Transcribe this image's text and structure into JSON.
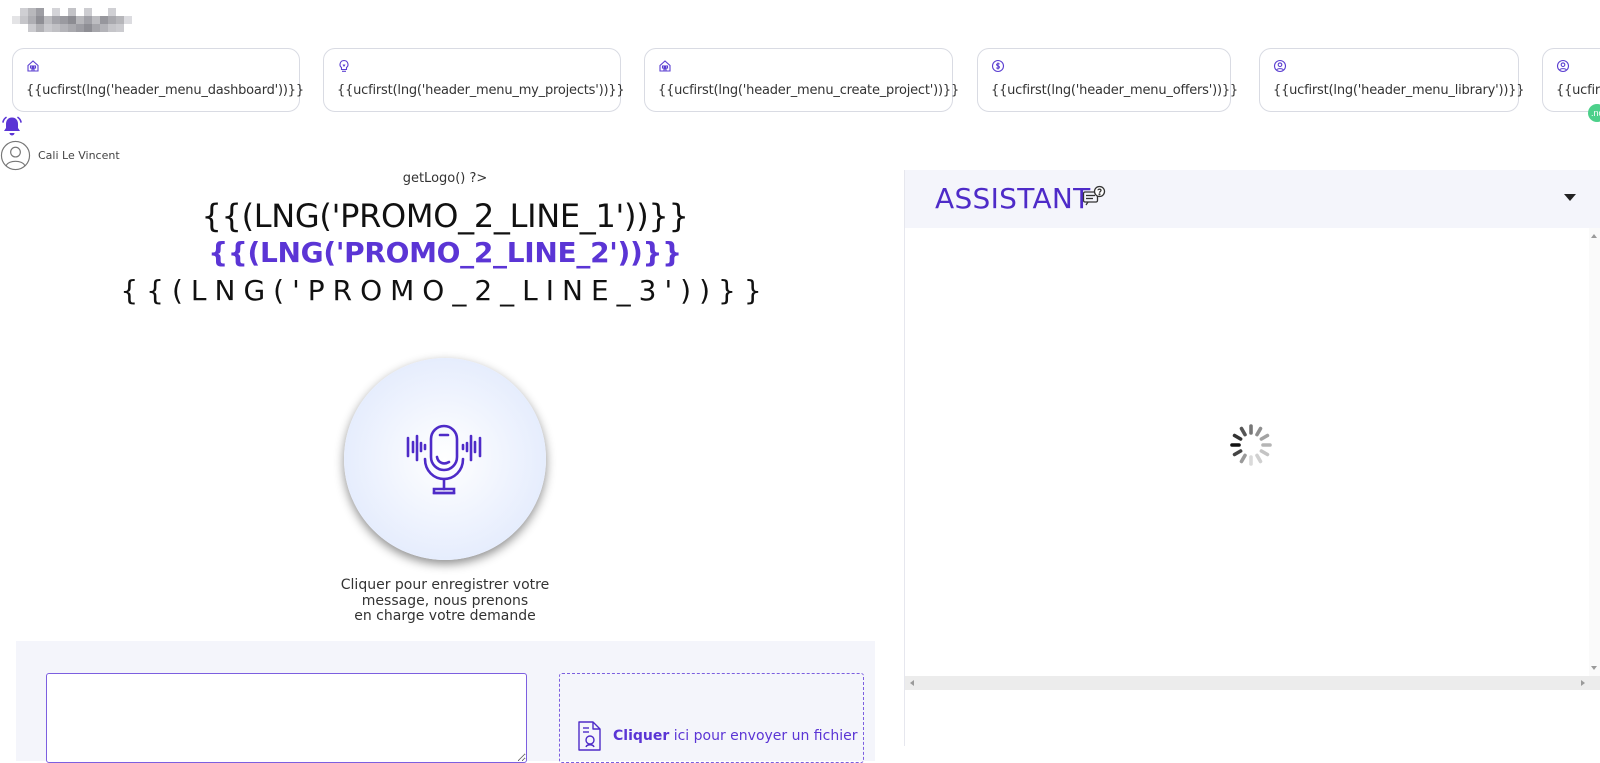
{
  "header": {
    "menu": [
      {
        "icon": "dashboard-icon",
        "label": "{{ucfirst(lng('header_menu_dashboard'))}}"
      },
      {
        "icon": "lightbulb-icon",
        "label": "{{ucfirst(lng('header_menu_my_projects'))}}"
      },
      {
        "icon": "create-project-icon",
        "label": "{{ucfirst(lng('header_menu_create_project'))}}"
      },
      {
        "icon": "offers-icon",
        "label": "{{ucfirst(lng('header_menu_offers'))}}"
      },
      {
        "icon": "library-icon",
        "label": "{{ucfirst(lng('header_menu_library'))}}"
      },
      {
        "icon": "user-circle-icon",
        "label": "{{ucfirs"
      }
    ],
    "notification_badge": ".no"
  },
  "user": {
    "name": "Cali Le Vincent"
  },
  "main": {
    "getlogo": "getLogo() ?>",
    "promo_line_1": "{{(LNG('PROMO_2_LINE_1'))}}",
    "promo_line_2": "{{(LNG('PROMO_2_LINE_2'))}}",
    "promo_line_3": "{{(LNG('PROMO_2_LINE_3'))}}",
    "mic_help_1": "Cliquer pour enregistrer votre",
    "mic_help_2": "message, nous prenons",
    "mic_help_3": "en charge votre demande",
    "upload_bold": "Cliquer",
    "upload_rest": " ici pour envoyer un fichier"
  },
  "assistant": {
    "title": "ASSISTANT"
  },
  "colors": {
    "accent": "#5b35d5",
    "panel_bg": "#f4f5fb",
    "badge": "#4cd08a"
  }
}
